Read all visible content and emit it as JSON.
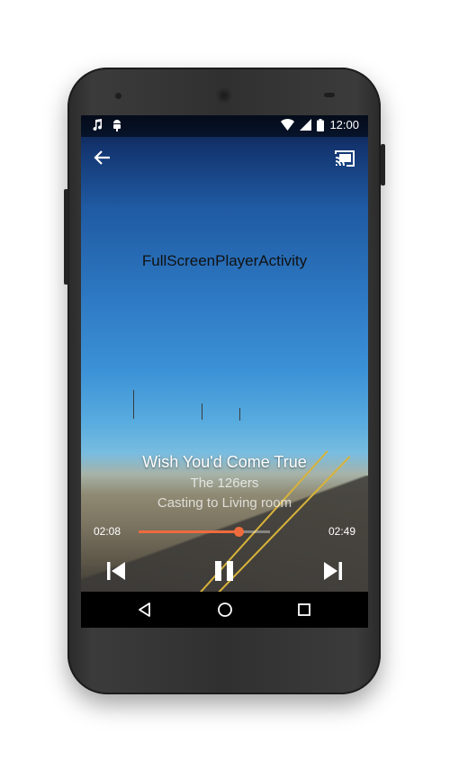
{
  "status_bar": {
    "time": "12:00",
    "left_icons": [
      "music-note-icon",
      "android-debug-icon"
    ],
    "right_icons": [
      "wifi-icon",
      "cell-signal-icon",
      "battery-icon"
    ]
  },
  "toolbar": {
    "back_icon": "arrow-back-icon",
    "cast_icon": "cast-connected-icon"
  },
  "activity_label": "FullScreenPlayerActivity",
  "track": {
    "title": "Wish You'd Come True",
    "artist": "The 126ers",
    "cast_status": "Casting to Living room"
  },
  "playback": {
    "elapsed": "02:08",
    "duration": "02:49",
    "progress_fraction": 0.757,
    "accent_color": "#ee6b3d"
  },
  "controls": {
    "previous_icon": "skip-previous-icon",
    "pause_icon": "pause-icon",
    "next_icon": "skip-next-icon"
  },
  "nav_bar": {
    "back_icon": "nav-back-icon",
    "home_icon": "nav-home-icon",
    "recents_icon": "nav-recents-icon"
  }
}
